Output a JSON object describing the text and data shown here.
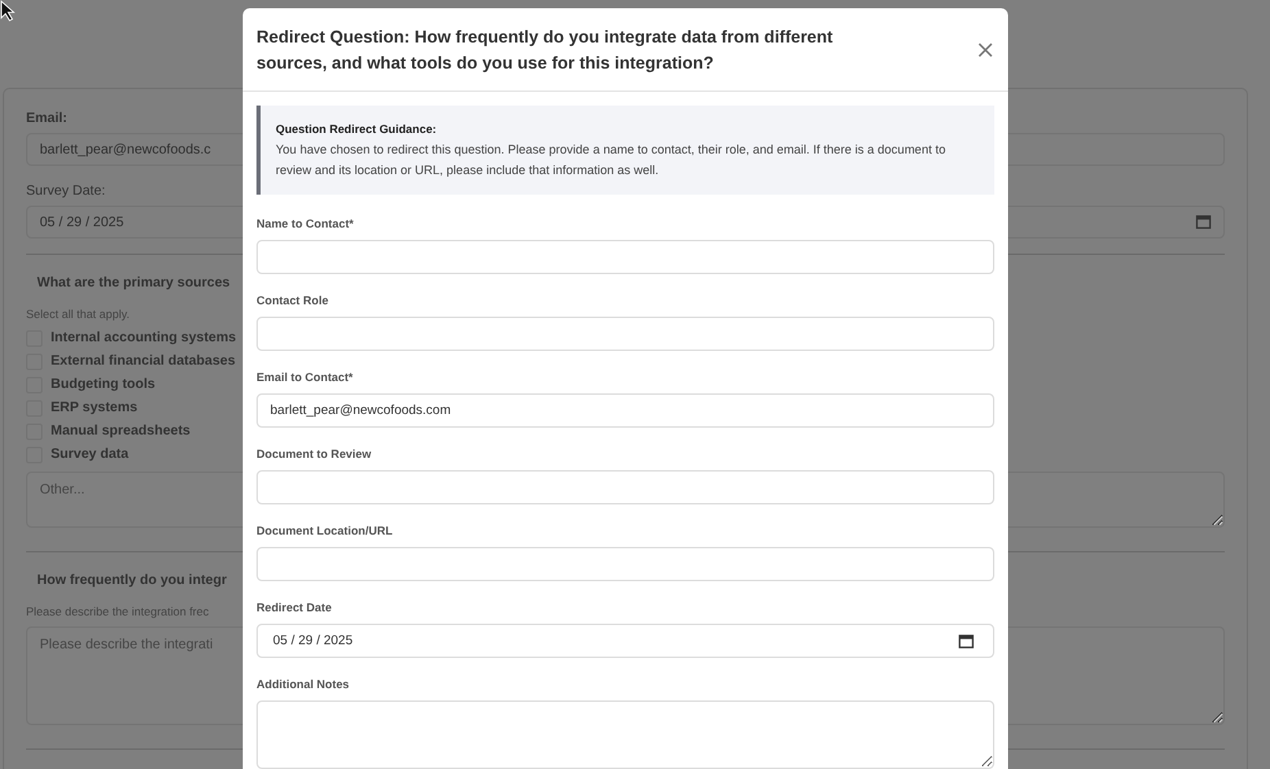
{
  "page": {
    "email_label": "Email:",
    "email_value": "barlett_pear@newcofoods.c",
    "survey_date_label": "Survey Date:",
    "survey_date_value": "05 / 29 / 2025",
    "questions": [
      {
        "kind": "checklist",
        "text": "What are the primary sources",
        "hint": "Select all that apply.",
        "options": [
          {
            "label": "Internal accounting systems",
            "checked": false
          },
          {
            "label": "External financial databases",
            "checked": false
          },
          {
            "label": "Budgeting tools",
            "checked": false
          },
          {
            "label": "ERP systems",
            "checked": false
          },
          {
            "label": "Manual spreadsheets",
            "checked": false
          },
          {
            "label": "Survey data",
            "checked": false
          }
        ],
        "other_placeholder": "Other..."
      },
      {
        "kind": "text",
        "text": "How frequently do you integr",
        "hint": "Please describe the integration frec",
        "placeholder": "Please describe the integrati"
      }
    ]
  },
  "modal": {
    "title": "Redirect Question: How frequently do you integrate data from different sources, and what tools do you use for this integration?",
    "guidance": {
      "heading": "Question Redirect Guidance:",
      "text": "You have chosen to redirect this question. Please provide a name to contact, their role, and email. If there is a document to review and its location or URL, please include that information as well."
    },
    "fields": [
      {
        "kind": "text",
        "label": "Name to Contact*"
      },
      {
        "kind": "text",
        "label": "Contact Role"
      },
      {
        "kind": "text",
        "label": "Email to Contact*",
        "value": "barlett_pear@newcofoods.com"
      },
      {
        "kind": "text",
        "label": "Document to Review"
      },
      {
        "kind": "text",
        "label": "Document Location/URL"
      },
      {
        "kind": "date",
        "label": "Redirect Date",
        "value": "05 / 29 / 2025"
      },
      {
        "kind": "textarea",
        "label": "Additional Notes"
      }
    ]
  }
}
